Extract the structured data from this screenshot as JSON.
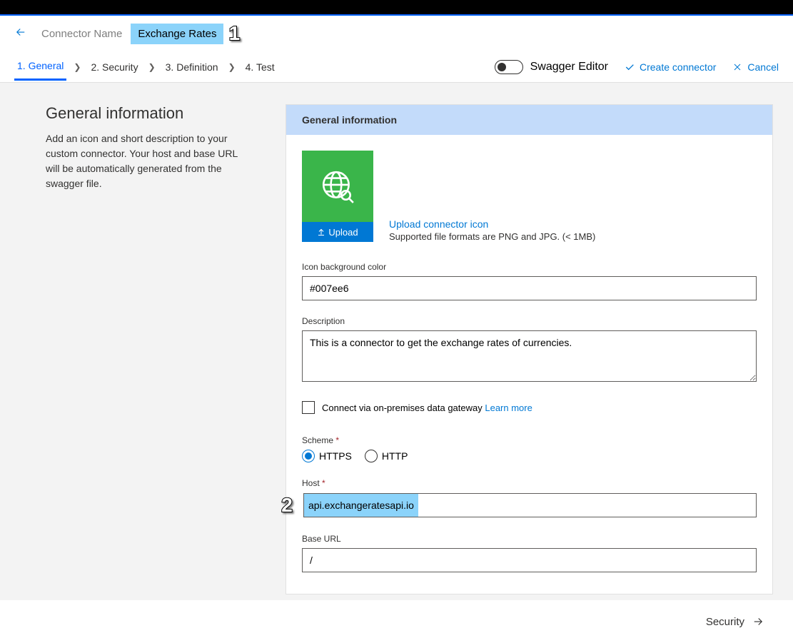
{
  "header": {
    "connector_label": "Connector Name",
    "connector_name": "Exchange Rates"
  },
  "steps": {
    "s1": "1. General",
    "s2": "2. Security",
    "s3": "3. Definition",
    "s4": "4. Test"
  },
  "actions": {
    "swagger": "Swagger Editor",
    "create": "Create connector",
    "cancel": "Cancel"
  },
  "left": {
    "title": "General information",
    "desc": "Add an icon and short description to your custom connector. Your host and base URL will be automatically generated from the swagger file."
  },
  "panel": {
    "title": "General information",
    "upload": "Upload",
    "icon_link": "Upload connector icon",
    "icon_sub": "Supported file formats are PNG and JPG. (< 1MB)",
    "bg_label": "Icon background color",
    "bg_value": "#007ee6",
    "desc_label": "Description",
    "desc_value": "This is a connector to get the exchange rates of currencies.",
    "gateway_label": "Connect via on-premises data gateway",
    "learn_more": "Learn more",
    "scheme_label": "Scheme",
    "https": "HTTPS",
    "http": "HTTP",
    "host_label": "Host",
    "host_value": "api.exchangeratesapi.io",
    "baseurl_label": "Base URL",
    "baseurl_value": "/"
  },
  "footer": {
    "next": "Security"
  },
  "callouts": {
    "c1": "1",
    "c2": "2"
  }
}
